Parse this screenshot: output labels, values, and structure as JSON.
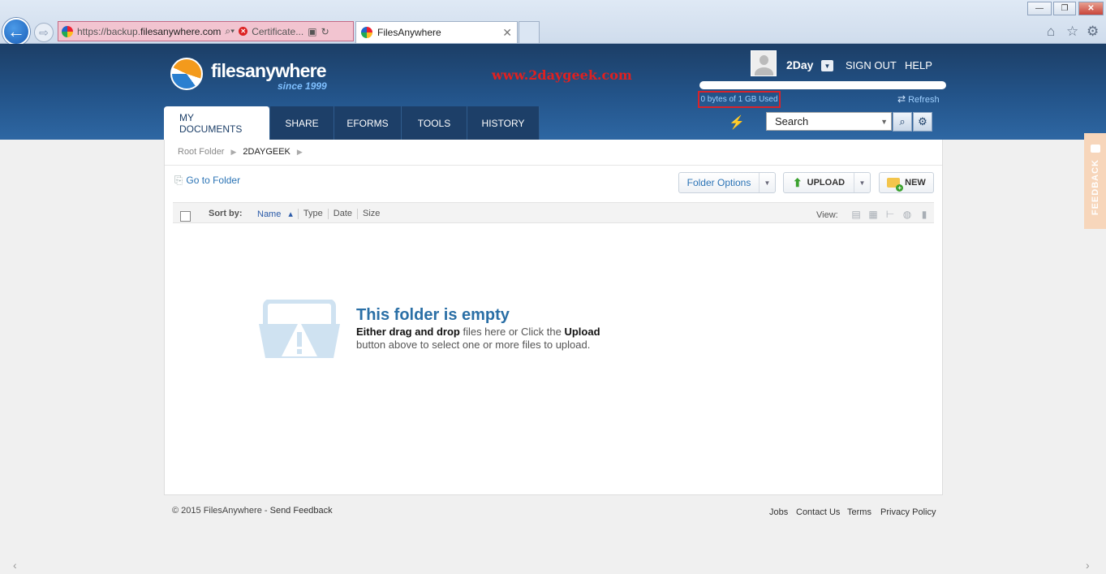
{
  "browser": {
    "url_prefix": "https://backup.",
    "url_host": "filesanywhere.com",
    "cert_label": "Certificate...",
    "tab_title": "FilesAnywhere",
    "back_glyph": "←",
    "forward_glyph": "⇨",
    "win_min": "—",
    "win_max": "❐",
    "win_close": "✕",
    "icons": [
      "home-icon",
      "favorites-star-icon",
      "tools-gear-icon"
    ]
  },
  "header": {
    "logo_text": "filesanywhere",
    "logo_since": "since 1999",
    "watermark": "www.2daygeek.com",
    "username": "2Day",
    "sign_out": "SIGN OUT",
    "help": "HELP",
    "quota_text": "0 bytes of 1 GB Used",
    "quota_used_fraction": 0,
    "refresh": "Refresh",
    "search_placeholder": "Search"
  },
  "nav": {
    "tabs": [
      {
        "label": "MY DOCUMENTS",
        "active": true
      },
      {
        "label": "SHARE",
        "active": false
      },
      {
        "label": "EFORMS",
        "active": false
      },
      {
        "label": "TOOLS",
        "active": false
      },
      {
        "label": "HISTORY",
        "active": false
      }
    ]
  },
  "breadcrumb": {
    "root": "Root Folder",
    "current": "2DAYGEEK"
  },
  "toolbar": {
    "goto_folder": "Go to Folder",
    "folder_options": "Folder Options",
    "upload": "UPLOAD",
    "new": "NEW"
  },
  "sortbar": {
    "sort_by": "Sort by:",
    "columns": [
      "Name",
      "Type",
      "Date",
      "Size"
    ],
    "active_column": "Name",
    "view_label": "View:"
  },
  "empty_state": {
    "title": "This folder is empty",
    "line1_bold_a": "Either drag and drop",
    "line1_mid": " files here or Click the ",
    "line1_bold_b": "Upload",
    "line2": "button above to select one or more files to upload."
  },
  "footer": {
    "copyright": "© 2015 FilesAnywhere - ",
    "send_feedback": "Send Feedback",
    "links": [
      "Jobs",
      "Contact Us",
      "Terms",
      "Privacy Policy"
    ]
  },
  "feedback_tab": "FEEDBACK",
  "colors": {
    "header_dark": "#1c3e66",
    "accent_blue": "#2a73b5",
    "highlight_red": "#d8232a",
    "feedback_orange": "#f7d6bb"
  }
}
